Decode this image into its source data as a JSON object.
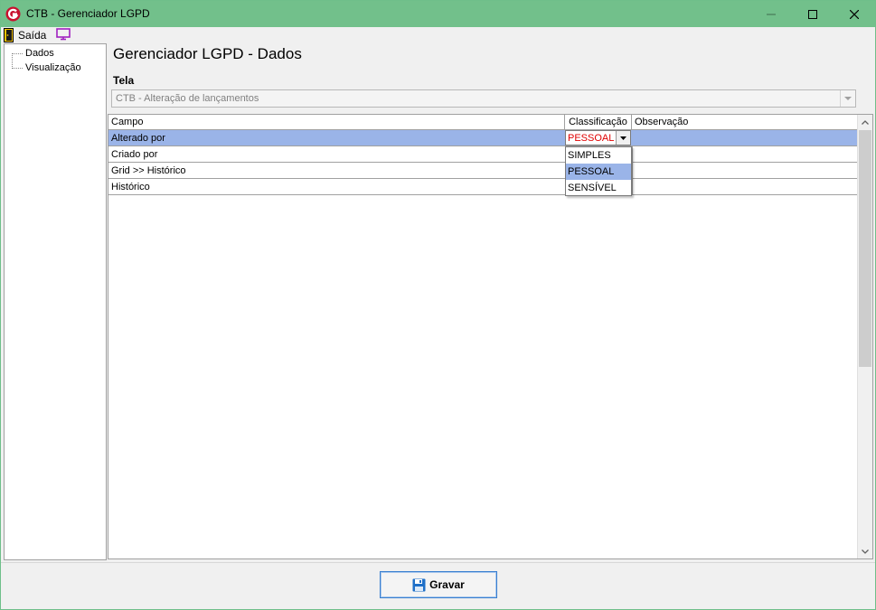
{
  "window": {
    "title": "CTB - Gerenciador LGPD"
  },
  "menu": {
    "exit_label": "Saída"
  },
  "tree": {
    "items": [
      {
        "label": "Dados"
      },
      {
        "label": "Visualização"
      }
    ]
  },
  "page": {
    "title": "Gerenciador LGPD - Dados"
  },
  "tela": {
    "label": "Tela",
    "value": "CTB - Alteração de lançamentos"
  },
  "grid": {
    "columns": [
      "Campo",
      "Classificação",
      "Observação"
    ],
    "rows": [
      {
        "campo": "Alterado por",
        "classificacao": "PESSOAL",
        "observacao": ""
      },
      {
        "campo": "Criado por",
        "classificacao": "",
        "observacao": ""
      },
      {
        "campo": "Grid >> Histórico",
        "classificacao": "",
        "observacao": ""
      },
      {
        "campo": "Histórico",
        "classificacao": "",
        "observacao": ""
      }
    ]
  },
  "dropdown": {
    "options": [
      "SIMPLES",
      "PESSOAL",
      "SENSÍVEL"
    ],
    "highlighted": "PESSOAL"
  },
  "footer": {
    "save_label": "Gravar"
  },
  "colors": {
    "titlebar": "#72c08b",
    "selection": "#9ab4e8",
    "error_text": "#e00000",
    "accent": "#3a7fd0"
  }
}
